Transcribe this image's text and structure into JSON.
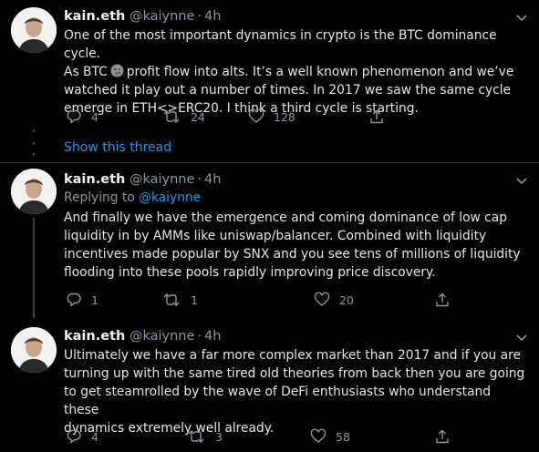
{
  "tweets": [
    {
      "name": "kain.eth",
      "handle": "@kaiynne",
      "dot": "·",
      "time": "4h",
      "text_lines": [
        "One of the most important dynamics in crypto is the BTC dominance cycle.",
        "As BTC",
        "profit flow into alts. It’s a well known phenomenon and we’ve",
        "watched it play out a number of times. In 2017 we saw the same cycle",
        "emerge in ETH<>ERC20. I think a third cycle is starting."
      ],
      "emoji": "smirk-emoji",
      "replies": "4",
      "retweets": "24",
      "likes": "128"
    },
    {
      "name": "kain.eth",
      "handle": "@kaiynne",
      "dot": "·",
      "time": "4h",
      "replying_prefix": "Replying to",
      "replying_link": "@kaiynne",
      "text_lines": [
        "And finally we have the emergence and coming dominance of low cap",
        "liquidity in by AMMs like uniswap/balancer. Combined with liquidity",
        "incentives made popular by SNX and you see tens of millions of liquidity",
        "flooding into these pools rapidly improving price discovery."
      ],
      "replies": "1",
      "retweets": "1",
      "likes": "20"
    },
    {
      "name": "kain.eth",
      "handle": "@kaiynne",
      "dot": "·",
      "time": "4h",
      "text_lines": [
        "Ultimately we have a far more complex market than 2017 and if you are",
        "turning up with the same tired old theories from back then you are going",
        "to get steamrolled by the wave of DeFi enthusiasts who understand these",
        "dynamics extremely well already."
      ],
      "replies": "4",
      "retweets": "3",
      "likes": "58"
    }
  ],
  "show_thread": "Show this thread",
  "colors": {
    "background": "#000000",
    "text": "#e6e6e6",
    "muted": "#8b98a5",
    "link": "#1d9bf0",
    "divider": "#2f3336"
  }
}
